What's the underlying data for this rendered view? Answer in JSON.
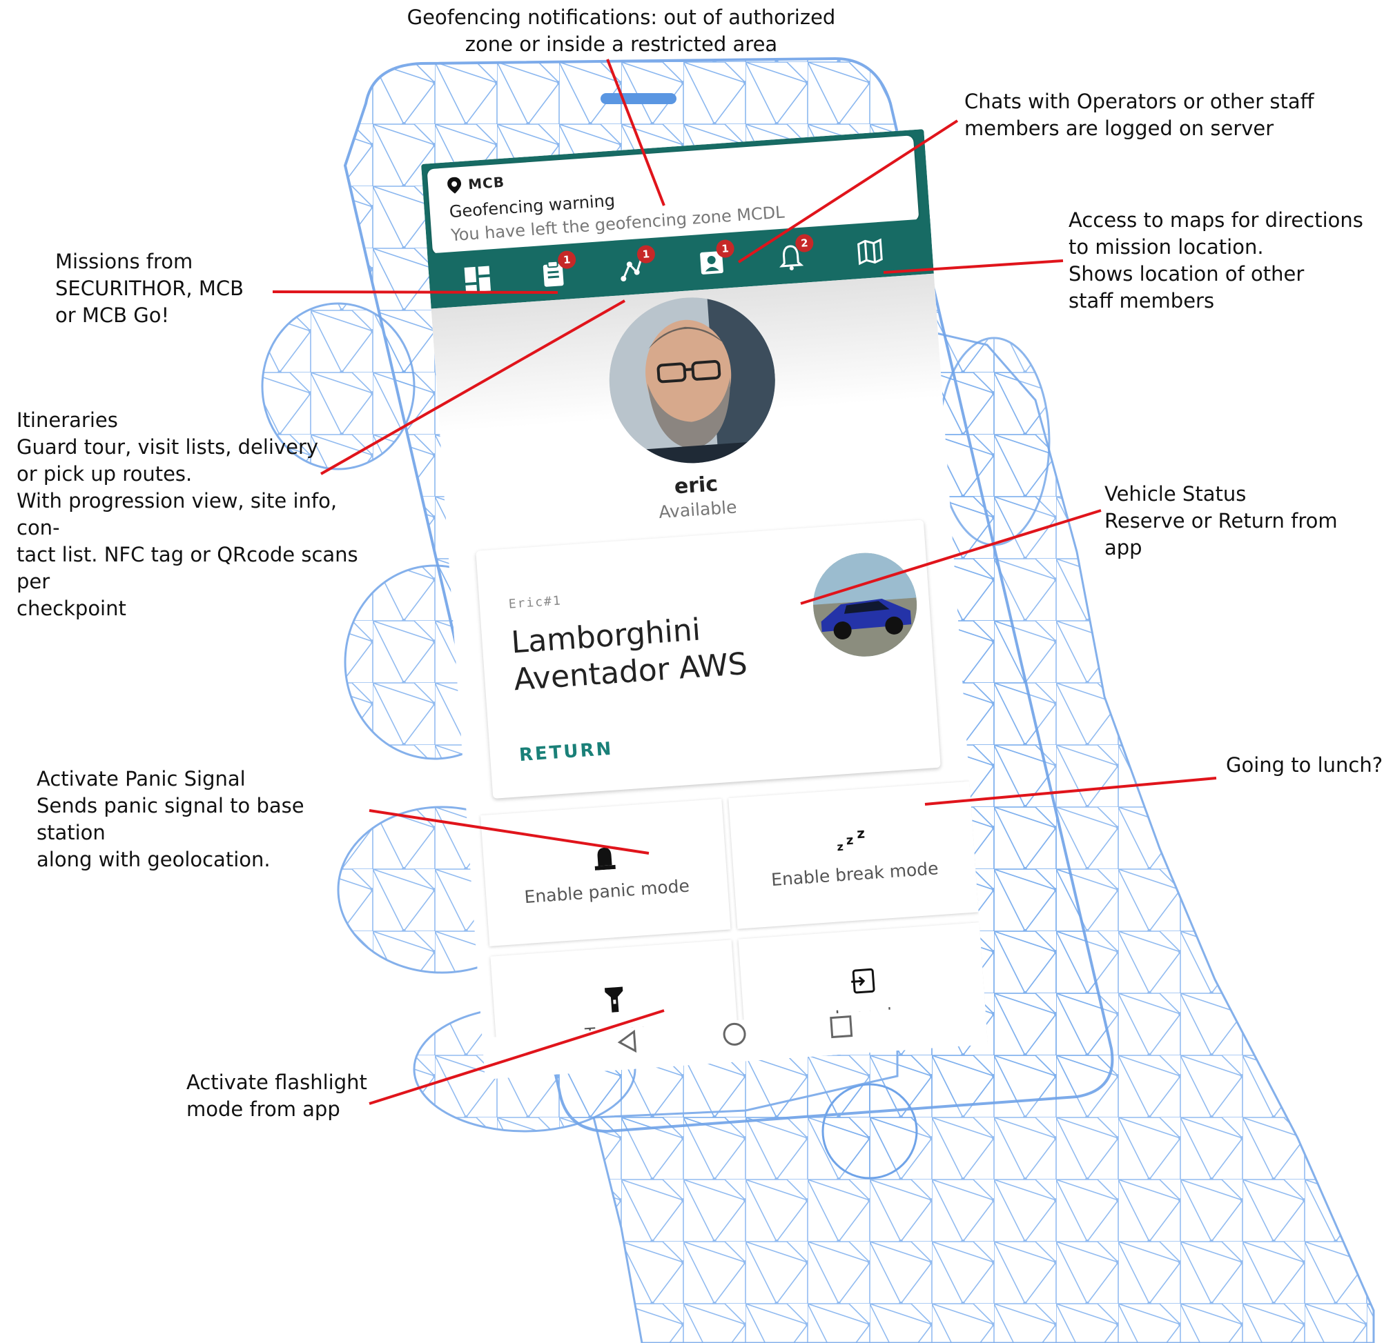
{
  "annotations": {
    "geofencing": [
      "Geofencing notifications: out of authorized",
      "zone or inside a restricted area"
    ],
    "chats": [
      "Chats with Operators or other staff",
      "members are logged on server"
    ],
    "missions": [
      "Missions from",
      "SECURITHOR, MCB",
      "or MCB Go!"
    ],
    "maps": [
      "Access to maps for directions",
      "to mission location.",
      "Shows location of other",
      "staff members"
    ],
    "itineraries": [
      "Itineraries",
      "Guard tour, visit lists, delivery",
      "or pick up routes.",
      "With progression view, site info, con-",
      "tact list. NFC tag or QRcode scans per",
      "checkpoint"
    ],
    "vehicle": [
      "Vehicle Status",
      "Reserve or Return from app"
    ],
    "lunch": [
      "Going to lunch?"
    ],
    "panic": [
      "Activate Panic Signal",
      "Sends panic signal to base station",
      "along with geolocation."
    ],
    "flashlight": [
      "Activate flashlight",
      "mode from app"
    ]
  },
  "notification": {
    "source": "MCB",
    "title": "Geofencing warning",
    "body": "You have left the geofencing zone  MCDL"
  },
  "tabs": [
    {
      "icon": "dashboard-icon",
      "badge": ""
    },
    {
      "icon": "clipboard-icon",
      "badge": "1"
    },
    {
      "icon": "route-icon",
      "badge": "1"
    },
    {
      "icon": "contact-card-icon",
      "badge": "1"
    },
    {
      "icon": "bell-icon",
      "badge": "2"
    },
    {
      "icon": "map-icon",
      "badge": ""
    }
  ],
  "profile": {
    "name": "eric",
    "status": "Available"
  },
  "vehicle": {
    "tag": "Eric#1",
    "name": "Lamborghini Aventador AWS",
    "action": "RETURN"
  },
  "tiles": {
    "panic": {
      "icon": "siren-icon",
      "label": "Enable panic mode"
    },
    "break": {
      "icon": "zzz-icon",
      "label": "Enable break mode"
    },
    "flash": {
      "icon": "flashlight-icon",
      "label": "Turn on"
    },
    "logout": {
      "icon": "logout-icon",
      "label": "Logout"
    }
  },
  "colors": {
    "app_bar": "#176b64",
    "accent": "#1a8078",
    "badge": "#c62828",
    "leader_line": "#e0141b",
    "wireframe": "#6fa3e8"
  }
}
